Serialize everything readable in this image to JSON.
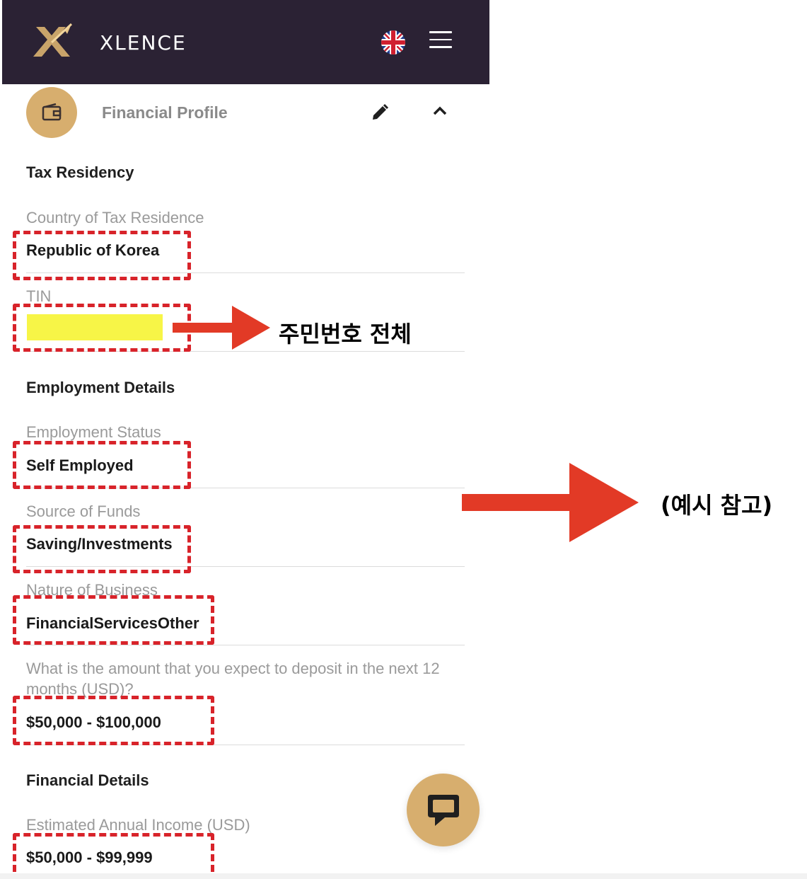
{
  "header": {
    "brand": "XLENCE",
    "language_icon": "uk-flag-icon",
    "menu_icon": "hamburger-menu-icon",
    "background": "#2b2234"
  },
  "section": {
    "title": "Financial Profile",
    "icon": "wallet-icon",
    "edit_icon": "pencil-icon",
    "collapse_icon": "chevron-up-icon",
    "accent": "#d7ae6e"
  },
  "tax": {
    "group_title": "Tax Residency",
    "country_label": "Country of Tax Residence",
    "country_value": "Republic of Korea",
    "tin_label": "TIN",
    "tin_value": ""
  },
  "employment": {
    "group_title": "Employment Details",
    "status_label": "Employment Status",
    "status_value": "Self Employed",
    "funds_label": "Source of Funds",
    "funds_value": "Saving/Investments",
    "nature_label": "Nature of Business",
    "nature_value": "FinancialServicesOther",
    "deposit_label": "What is the amount that you expect to deposit in the next 12 months (USD)?",
    "deposit_value": "$50,000 - $100,000"
  },
  "financial": {
    "group_title": "Financial Details",
    "income_label": "Estimated Annual Income (USD)",
    "income_value": "$50,000 - $99,999"
  },
  "annotations": {
    "tin_note": "주민번호 전체",
    "example_note": "(예시 참고)",
    "highlight_color": "#d8232a",
    "marker_color": "#f7f547"
  },
  "chat": {
    "icon": "chat-bubble-icon"
  }
}
